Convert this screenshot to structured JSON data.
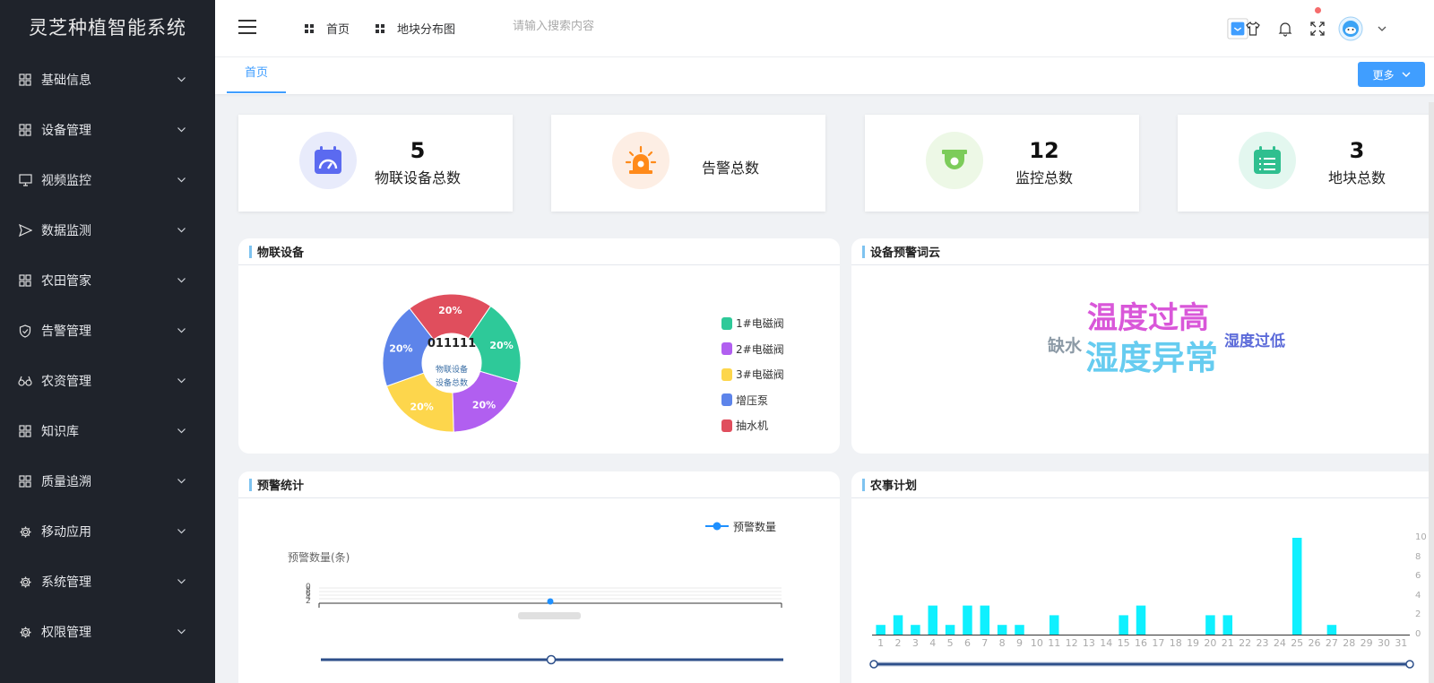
{
  "app_title": "灵芝种植智能系统",
  "sidebar": {
    "items": [
      {
        "label": "基础信息",
        "icon": "grid-icon"
      },
      {
        "label": "设备管理",
        "icon": "grid-icon"
      },
      {
        "label": "视频监控",
        "icon": "monitor-icon"
      },
      {
        "label": "数据监测",
        "icon": "send-icon"
      },
      {
        "label": "农田管家",
        "icon": "grid-icon"
      },
      {
        "label": "告警管理",
        "icon": "shield-check-icon"
      },
      {
        "label": "农资管理",
        "icon": "binoculars-icon"
      },
      {
        "label": "知识库",
        "icon": "grid-icon"
      },
      {
        "label": "质量追溯",
        "icon": "grid-icon"
      },
      {
        "label": "移动应用",
        "icon": "gear-icon"
      },
      {
        "label": "系统管理",
        "icon": "gear-icon"
      },
      {
        "label": "权限管理",
        "icon": "gear-icon"
      }
    ]
  },
  "header": {
    "nav": [
      {
        "label": "首页"
      },
      {
        "label": "地块分布图"
      }
    ],
    "search_placeholder": "请输入搜索内容"
  },
  "tabs": {
    "home_label": "首页",
    "more_label": "更多"
  },
  "stats": [
    {
      "value": "5",
      "label": "物联设备总数",
      "color": "#5b6af0"
    },
    {
      "value": "",
      "label": "告警总数",
      "color": "#ff8a1a"
    },
    {
      "value": "12",
      "label": "监控总数",
      "color": "#7ccc5a"
    },
    {
      "value": "3",
      "label": "地块总数",
      "color": "#2fbf8f"
    }
  ],
  "iot_panel": {
    "title": "物联设备",
    "center_value": "011111",
    "center_label_1": "物联设备",
    "center_label_2": "设备总数",
    "chart_data": {
      "type": "pie",
      "categories": [
        "1#电磁阀",
        "2#电磁阀",
        "3#电磁阀",
        "增压泵",
        "抽水机"
      ],
      "values": [
        20,
        20,
        20,
        20,
        20
      ],
      "labels": [
        "20%",
        "20%",
        "20%",
        "20%",
        "20%"
      ],
      "colors": [
        "#2ec999",
        "#b15ff0",
        "#fdd64c",
        "#5d84ea",
        "#e04e5d"
      ],
      "legend_position": "right"
    }
  },
  "wordcloud_panel": {
    "title": "设备预警词云",
    "words": [
      {
        "text": "温度过高",
        "color": "#d957d9"
      },
      {
        "text": "湿度异常",
        "color": "#66ccf0"
      },
      {
        "text": "缺水",
        "color": "#8c9aa6"
      },
      {
        "text": "湿度过低",
        "color": "#5b6ad9"
      }
    ]
  },
  "alert_panel": {
    "title": "预警统计",
    "chart_data": {
      "type": "line",
      "series": [
        {
          "name": "预警数量",
          "values": [
            0
          ]
        }
      ],
      "ylabel": "预警数量(条)",
      "ytick_labels": [
        "0",
        "8",
        "6",
        "4",
        "2"
      ],
      "legend_position": "top-right",
      "color": "#1e90ff"
    }
  },
  "farm_panel": {
    "title": "农事计划",
    "chart_data": {
      "type": "bar",
      "categories": [
        "1",
        "2",
        "3",
        "4",
        "5",
        "6",
        "7",
        "8",
        "9",
        "10",
        "11",
        "12",
        "13",
        "14",
        "15",
        "16",
        "17",
        "18",
        "19",
        "20",
        "21",
        "22",
        "23",
        "24",
        "25",
        "26",
        "27",
        "28",
        "29",
        "30",
        "31"
      ],
      "values": [
        1,
        2,
        1,
        3,
        1,
        3,
        3,
        1,
        1,
        0,
        2,
        0,
        0,
        0,
        2,
        3,
        0,
        0,
        0,
        2,
        2,
        0,
        0,
        0,
        10,
        0,
        1,
        0,
        0,
        0,
        0
      ],
      "ylim": [
        0,
        10
      ],
      "yticks": [
        "0",
        "2",
        "4",
        "6",
        "8",
        "10"
      ],
      "color": "#0ff0ff",
      "grid": false
    }
  }
}
